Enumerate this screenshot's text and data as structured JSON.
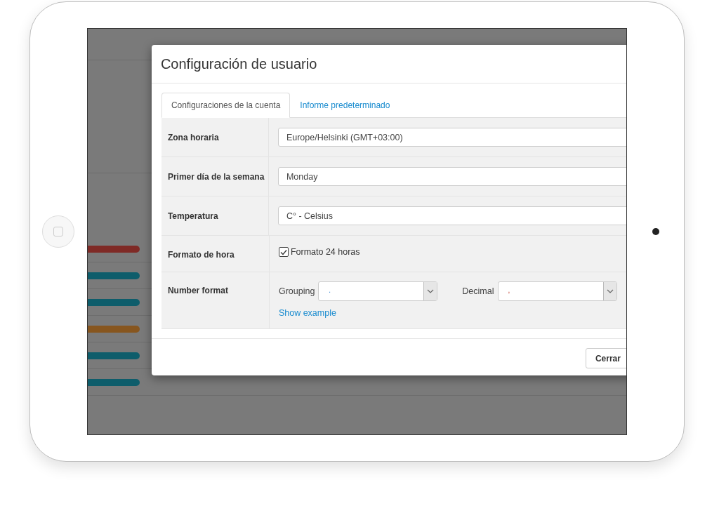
{
  "background_bars": [
    {
      "color": "#7f2a26"
    },
    {
      "color": "#0e5d6b"
    },
    {
      "color": "#0e5d6b"
    },
    {
      "color": "#87561f"
    },
    {
      "color": "#0e5d6b"
    },
    {
      "color": "#0e5d6b"
    }
  ],
  "dialog": {
    "title": "Configuración de usuario",
    "tabs": [
      {
        "label": "Configuraciones de la cuenta",
        "selected": true
      },
      {
        "label": "Informe predeterminado",
        "selected": false
      }
    ],
    "rows": [
      {
        "kind": "select",
        "label": "Zona horaria",
        "value": "Europe/Helsinki (GMT+03:00)"
      },
      {
        "kind": "select",
        "label": "Primer día de la semana",
        "value": "Monday"
      },
      {
        "kind": "select",
        "label": "Temperatura",
        "value": "C° - Celsius"
      },
      {
        "kind": "checkbox",
        "label": "Formato de hora",
        "text": "Formato 24 horas",
        "checked": true
      },
      {
        "kind": "number_format",
        "label": "Number format",
        "selects": [
          {
            "label": "Grouping",
            "value": "."
          },
          {
            "label": "Decimal",
            "value": ","
          }
        ],
        "link": "Show example"
      }
    ],
    "buttons": [
      "Cerrar"
    ]
  }
}
